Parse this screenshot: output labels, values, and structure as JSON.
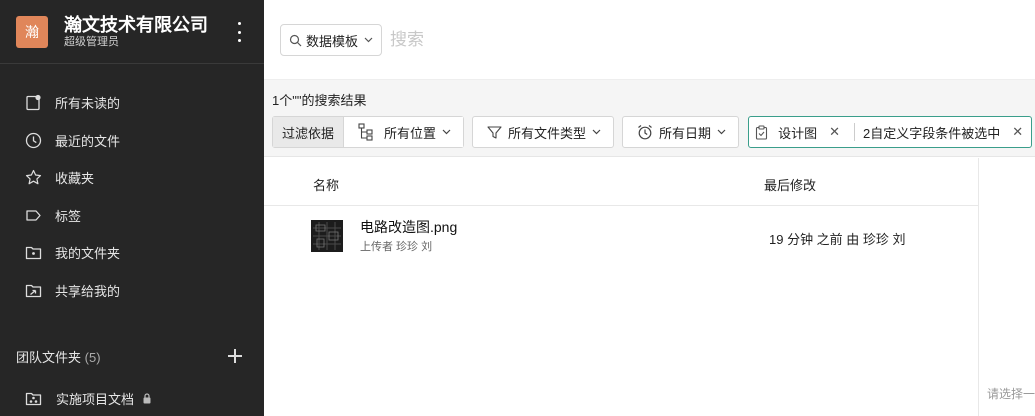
{
  "sidebar": {
    "org": {
      "logo_char": "瀚",
      "name": "瀚文技术有限公司",
      "role": "超级管理员",
      "accent": "#e0865a"
    },
    "nav": [
      {
        "label": "所有未读的",
        "icon": "unread-doc-icon"
      },
      {
        "label": "最近的文件",
        "icon": "clock-icon"
      },
      {
        "label": "收藏夹",
        "icon": "star-icon"
      },
      {
        "label": "标签",
        "icon": "tag-icon"
      },
      {
        "label": "我的文件夹",
        "icon": "folder-icon"
      },
      {
        "label": "共享给我的",
        "icon": "shared-folder-icon"
      }
    ],
    "team": {
      "title": "团队文件夹",
      "count": "(5)",
      "items": [
        {
          "label": "实施项目文档"
        }
      ]
    }
  },
  "search": {
    "scope_label": "数据模板",
    "placeholder": "搜索",
    "result_count": "1个\"\"的搜索结果"
  },
  "filters": {
    "label": "过滤依据",
    "location": "所有位置",
    "file_type": "所有文件类型",
    "date": "所有日期",
    "chips": [
      "设计图",
      "2自定义字段条件被选中"
    ],
    "chip_border": "#3a9e8b"
  },
  "table": {
    "columns": {
      "name": "名称",
      "modified": "最后修改"
    },
    "rows": [
      {
        "name": "电路改造图.png",
        "uploader": "上传者 珍珍 刘",
        "modified": "19 分钟 之前 由 珍珍 刘"
      }
    ]
  },
  "hint": "请选择一"
}
